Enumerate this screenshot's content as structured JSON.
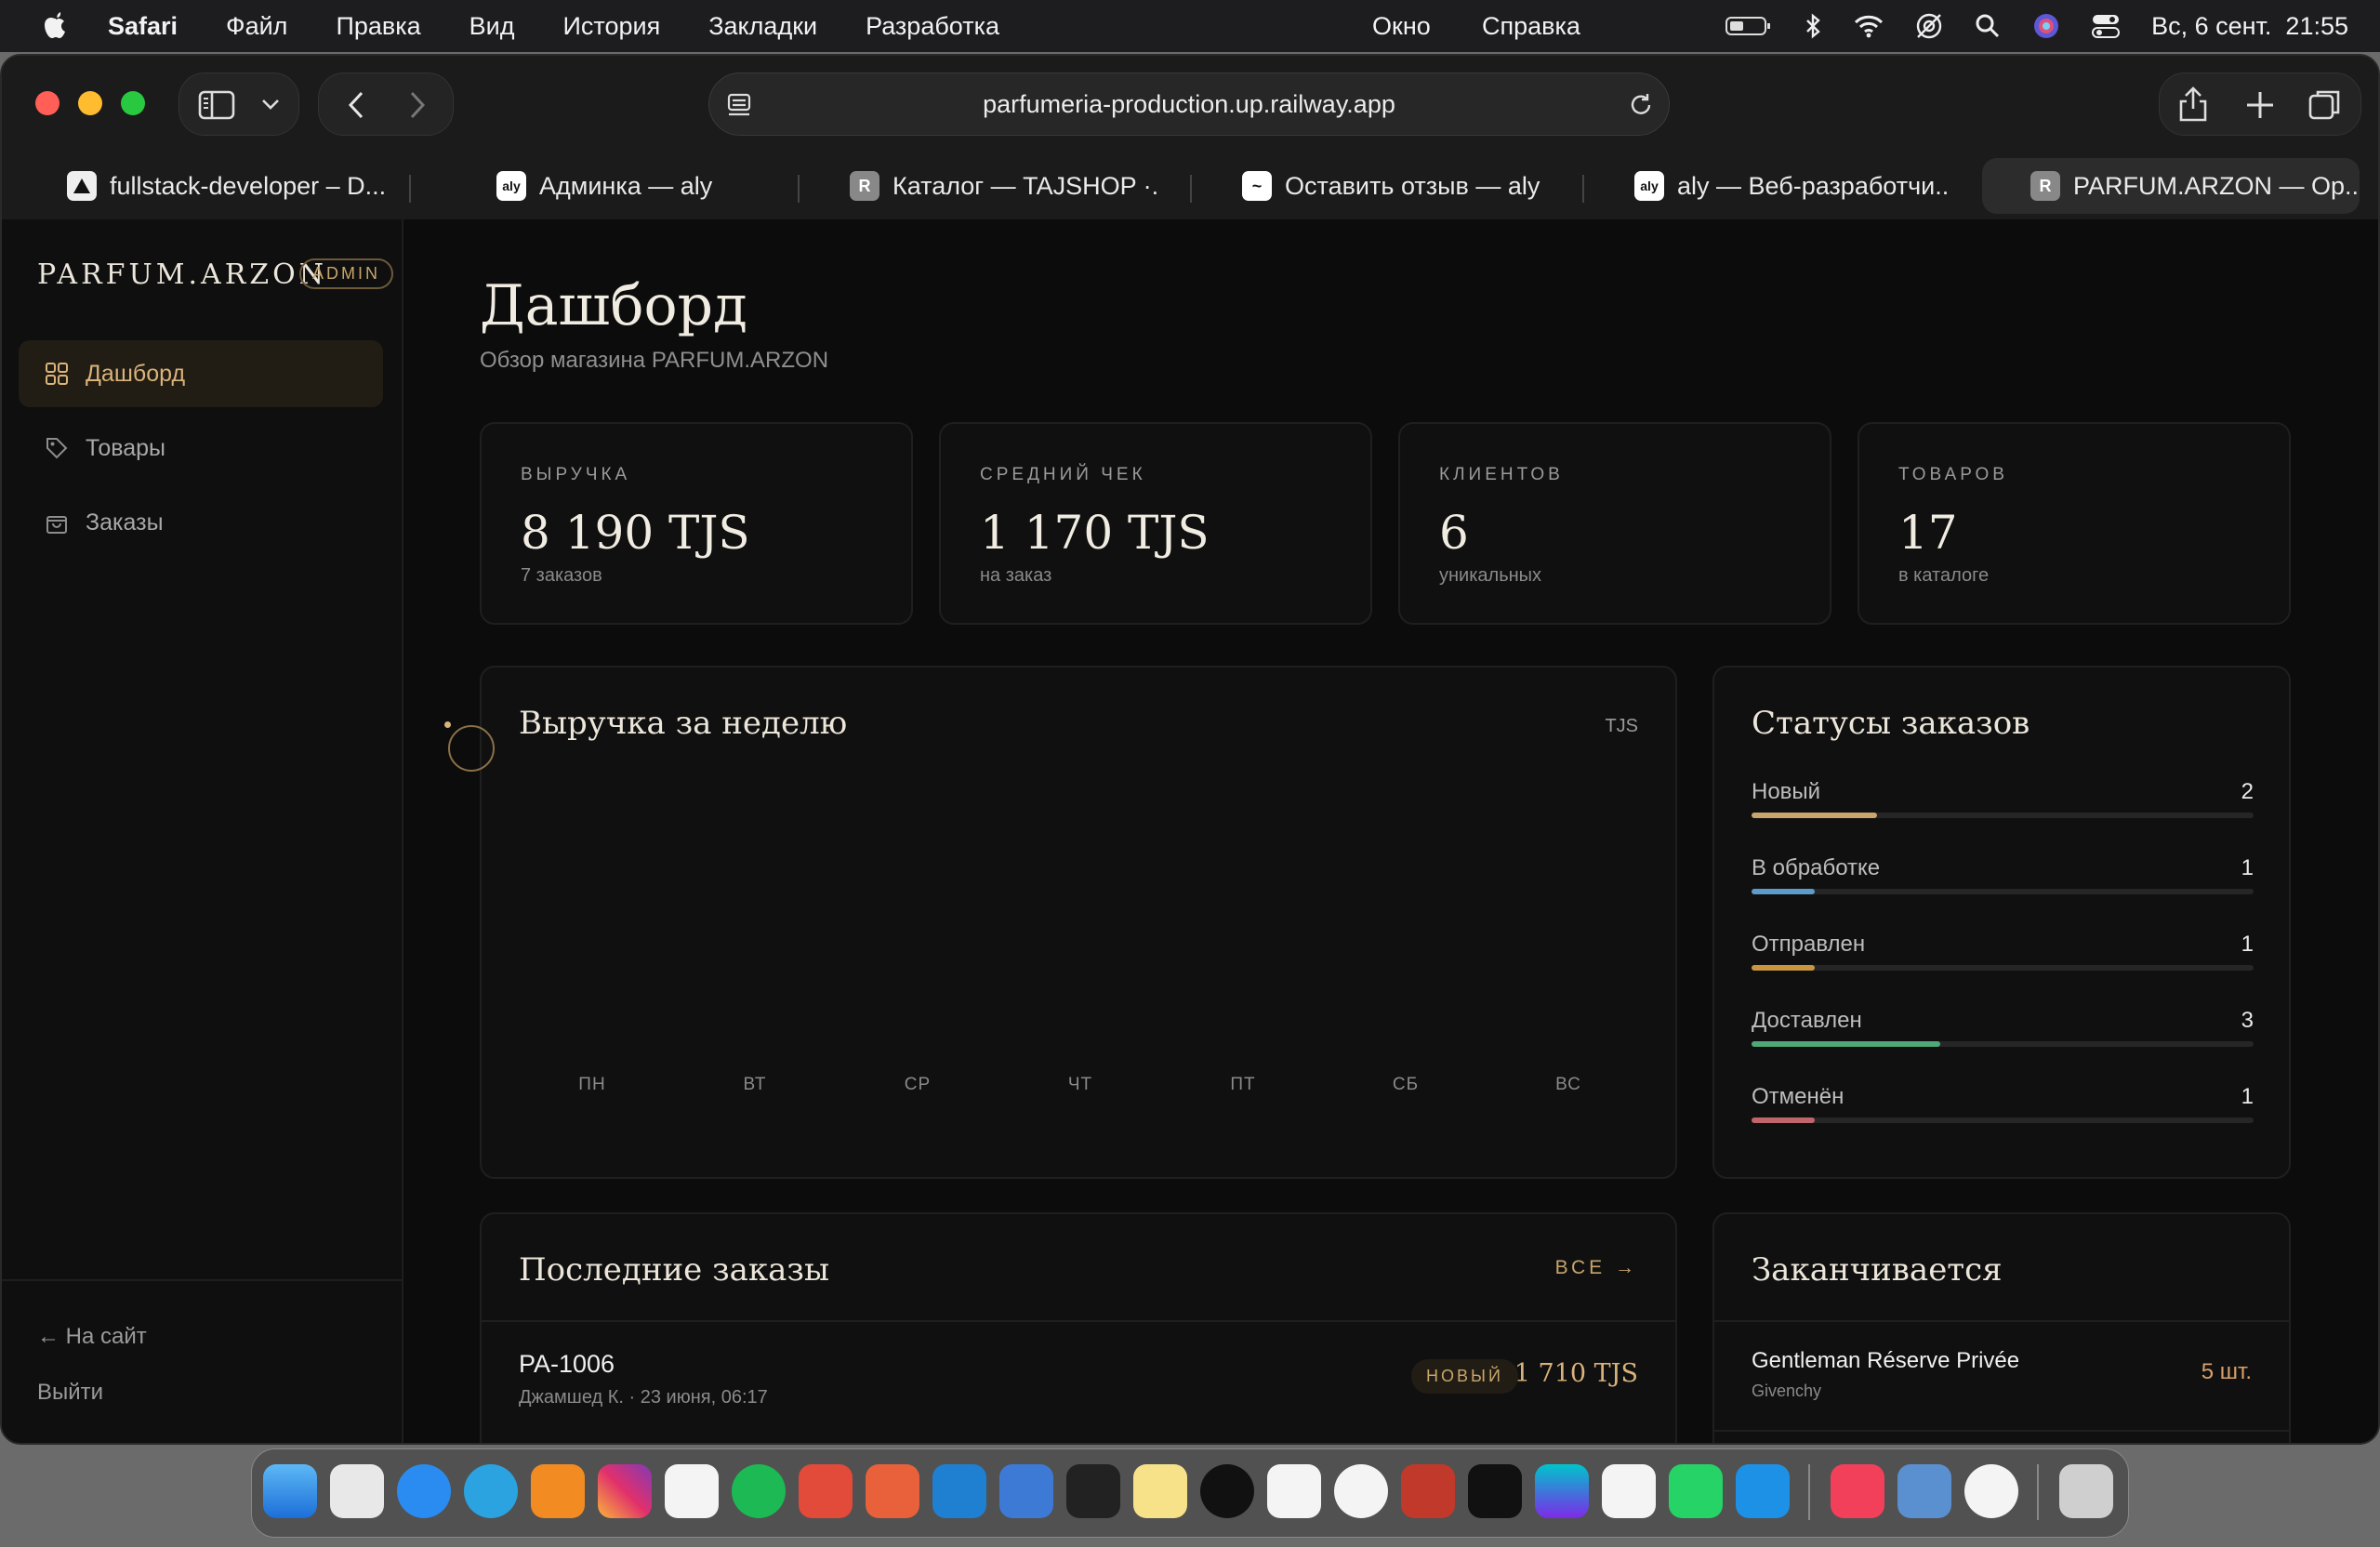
{
  "menubar": {
    "app": "Safari",
    "items": [
      "Файл",
      "Правка",
      "Вид",
      "История",
      "Закладки",
      "Разработка"
    ],
    "right_items": [
      "Окно",
      "Справка"
    ],
    "datetime": "Вс, 6 сент.  21:55"
  },
  "browser": {
    "url": "parfumeria-production.up.railway.app",
    "tabs": [
      {
        "title": "fullstack-developer – D...",
        "icon": "triangle-icon"
      },
      {
        "title": "Админка — aly",
        "icon": "aly-icon"
      },
      {
        "title": "Каталог — TAJSHOP ·...",
        "icon": "r-icon"
      },
      {
        "title": "Оставить отзыв — aly",
        "icon": "terminal-icon"
      },
      {
        "title": "aly — Веб-разработчи...",
        "icon": "aly-icon"
      },
      {
        "title": "PARFUM.ARZON — Op...",
        "icon": "r-icon",
        "active": true
      }
    ]
  },
  "sidebar": {
    "logo": "PARFUM.ARZON",
    "badge": "ADMIN",
    "nav": [
      {
        "label": "Дашборд",
        "icon": "grid-icon",
        "active": true
      },
      {
        "label": "Товары",
        "icon": "tag-icon"
      },
      {
        "label": "Заказы",
        "icon": "bag-icon"
      }
    ],
    "back_link": "← На сайт",
    "logout": "Выйти"
  },
  "page": {
    "title": "Дашборд",
    "subtitle": "Обзор магазина PARFUM.ARZON"
  },
  "stats": [
    {
      "label": "ВЫРУЧКА",
      "value": "8 190 TJS",
      "sub": "7 заказов"
    },
    {
      "label": "СРЕДНИЙ ЧЕК",
      "value": "1 170 TJS",
      "sub": "на заказ"
    },
    {
      "label": "КЛИЕНТОВ",
      "value": "6",
      "sub": "уникальных"
    },
    {
      "label": "ТОВАРОВ",
      "value": "17",
      "sub": "в каталоге"
    }
  ],
  "weekly": {
    "title": "Выручка за неделю",
    "unit": "TJS",
    "days": [
      "ПН",
      "ВТ",
      "СР",
      "ЧТ",
      "ПТ",
      "СБ",
      "ВС"
    ]
  },
  "chart_data": {
    "type": "bar",
    "categories": [
      "ПН",
      "ВТ",
      "СР",
      "ЧТ",
      "ПТ",
      "СБ",
      "ВС"
    ],
    "values": [
      0,
      0,
      0,
      0,
      0,
      0,
      0
    ],
    "ylabel": "TJS"
  },
  "statuses": {
    "title": "Статусы заказов",
    "items": [
      {
        "label": "Новый",
        "count": "2",
        "fraction": 0.25,
        "color": "#c9a66b"
      },
      {
        "label": "В обработке",
        "count": "1",
        "fraction": 0.125,
        "color": "#5d9bc8"
      },
      {
        "label": "Отправлен",
        "count": "1",
        "fraction": 0.125,
        "color": "#c9963f"
      },
      {
        "label": "Доставлен",
        "count": "3",
        "fraction": 0.375,
        "color": "#4fa877"
      },
      {
        "label": "Отменён",
        "count": "1",
        "fraction": 0.125,
        "color": "#c0656a"
      }
    ]
  },
  "recent_orders": {
    "title": "Последние заказы",
    "all_link": "ВСЕ →",
    "rows": [
      {
        "id": "PA-1006",
        "meta": "Джамшед К. · 23 июня, 06:17",
        "status": "НОВЫЙ",
        "amount": "1 710 TJS"
      }
    ]
  },
  "low_stock": {
    "title": "Заканчивается",
    "rows": [
      {
        "name": "Gentleman Réserve Privée",
        "brand": "Givenchy",
        "qty": "5 шт."
      }
    ]
  }
}
